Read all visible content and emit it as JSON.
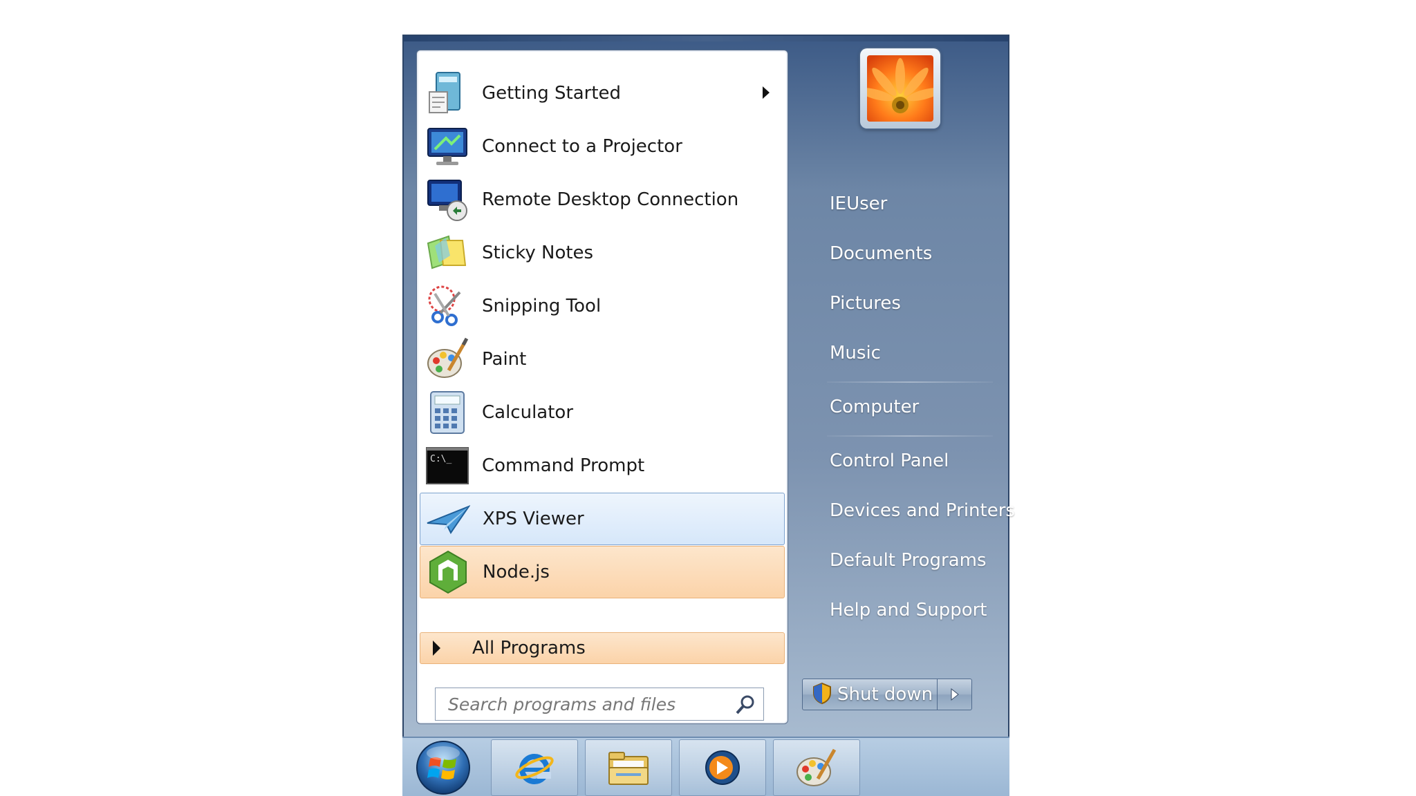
{
  "programs": [
    {
      "label": "Getting Started",
      "has_submenu": true,
      "icon": "getting-started-icon"
    },
    {
      "label": "Connect to a Projector",
      "icon": "projector-icon"
    },
    {
      "label": "Remote Desktop Connection",
      "icon": "remote-desktop-icon"
    },
    {
      "label": "Sticky Notes",
      "icon": "sticky-notes-icon"
    },
    {
      "label": "Snipping Tool",
      "icon": "scissors-icon"
    },
    {
      "label": "Paint",
      "icon": "paint-palette-icon"
    },
    {
      "label": "Calculator",
      "icon": "calculator-icon"
    },
    {
      "label": "Command Prompt",
      "icon": "command-prompt-icon",
      "icon_text": "C:\\_"
    },
    {
      "label": "XPS Viewer",
      "state": "selected",
      "icon": "xps-viewer-icon"
    },
    {
      "label": "Node.js",
      "state": "highlighted",
      "icon": "nodejs-icon"
    }
  ],
  "all_programs": {
    "label": "All Programs"
  },
  "search": {
    "placeholder": "Search programs and files"
  },
  "right_pane": {
    "user_name": "IEUser",
    "links": [
      "Documents",
      "Pictures",
      "Music",
      "Computer",
      "Control Panel",
      "Devices and Printers",
      "Default Programs",
      "Help and Support"
    ]
  },
  "shutdown": {
    "label": "Shut down"
  },
  "taskbar": {
    "items": [
      "start-orb",
      "internet-explorer-icon",
      "windows-explorer-icon",
      "media-player-icon",
      "paint-icon"
    ]
  },
  "colors": {
    "menu_frame": "#3c5a86",
    "selected_bg": "#d6e7fa",
    "highlight_bg": "#fbd3a9"
  }
}
